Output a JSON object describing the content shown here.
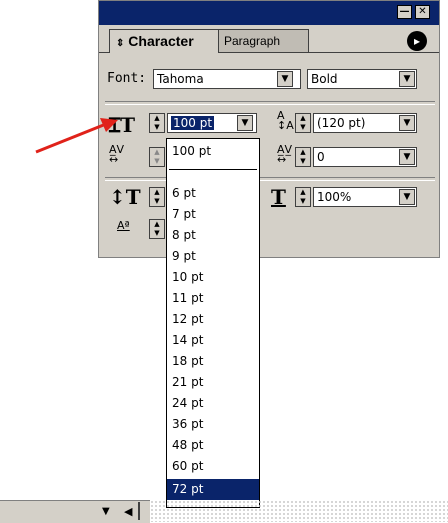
{
  "palette": {
    "tabs": {
      "character": "Character",
      "paragraph": "Paragraph"
    },
    "font_label": "Font:",
    "font_value": "Tahoma",
    "style_value": "Bold",
    "size_value": "100 pt",
    "leading_value": "(120 pt)",
    "tracking_value": "0",
    "horizontal_scale_value": "100%"
  },
  "size_dropdown": {
    "items": [
      "100 pt",
      "6 pt",
      "7 pt",
      "8 pt",
      "9 pt",
      "10 pt",
      "11 pt",
      "12 pt",
      "14 pt",
      "18 pt",
      "21 pt",
      "24 pt",
      "36 pt",
      "48 pt",
      "60 pt",
      "72 pt"
    ],
    "selected": "72 pt"
  },
  "colors": {
    "title_bar": "#0a246a",
    "selection": "#0a246a",
    "annotation_arrow": "#e0221a"
  },
  "icons": [
    "minimize-icon",
    "close-icon",
    "palette-menu-icon",
    "font-size-icon",
    "leading-icon",
    "kerning-icon",
    "tracking-icon",
    "vertical-scale-icon",
    "horizontal-scale-icon",
    "baseline-shift-icon",
    "annotation-arrow"
  ]
}
